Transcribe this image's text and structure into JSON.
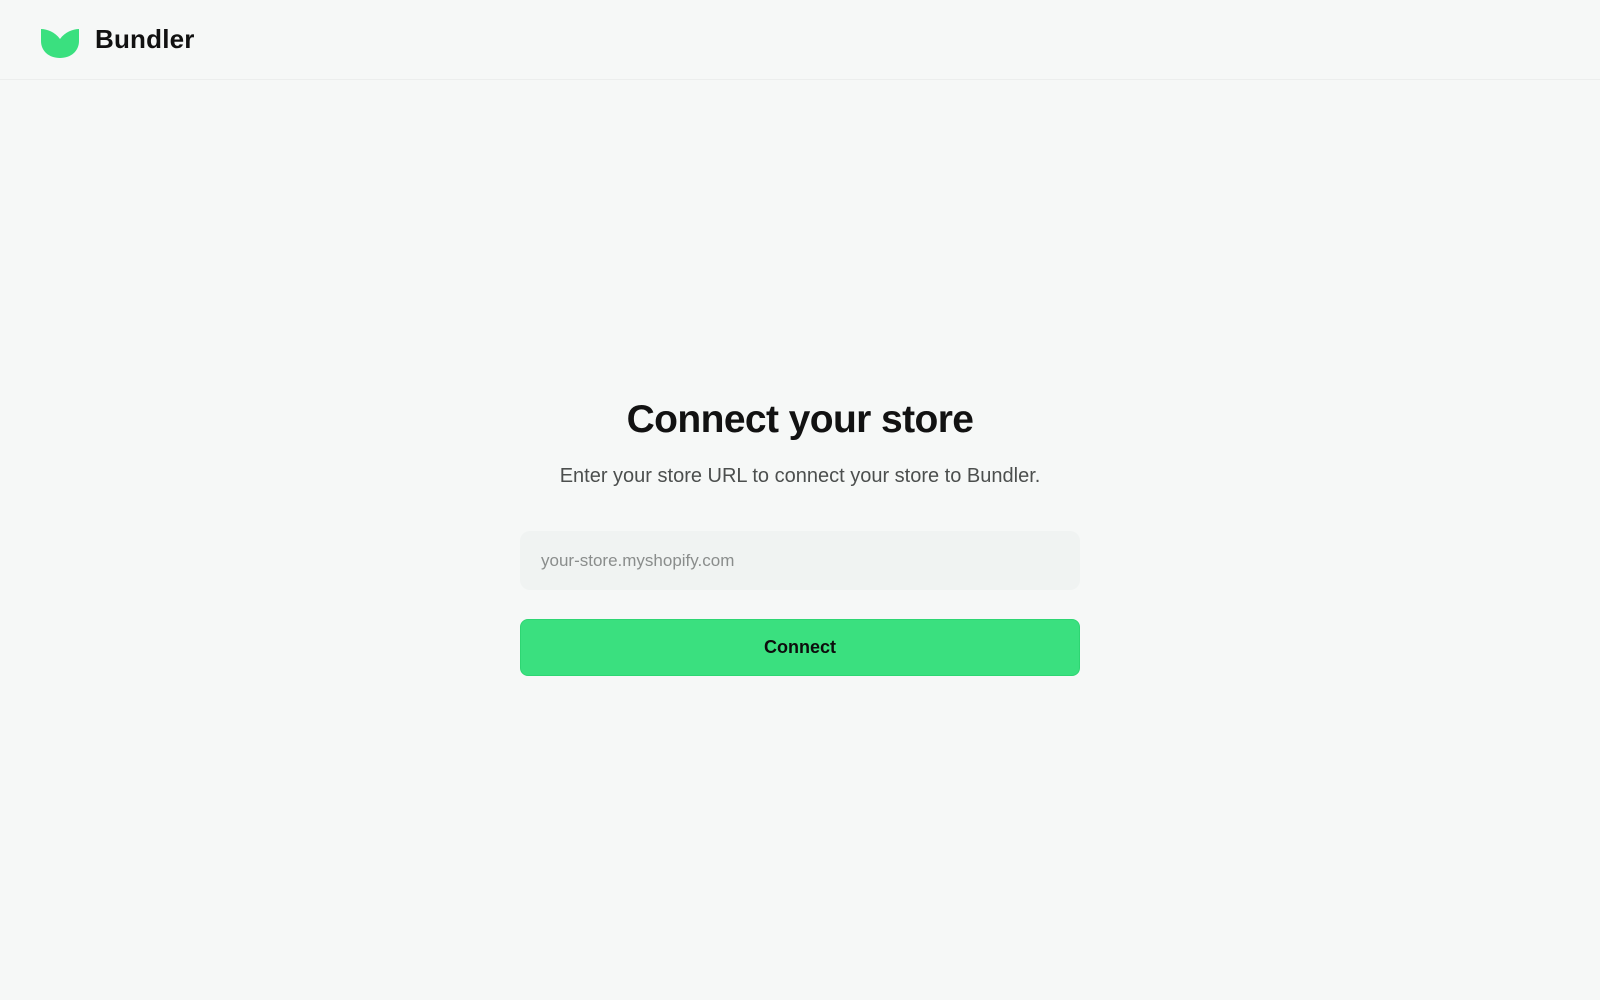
{
  "header": {
    "brand_name": "Bundler",
    "logo_icon": "bundler-leaf-logo",
    "brand_color": "#3ae07f"
  },
  "main": {
    "title": "Connect your store",
    "subtitle": "Enter your store URL to connect your store to Bundler.",
    "store_url_input": {
      "value": "",
      "placeholder": "your-store.myshopify.com"
    },
    "connect_button_label": "Connect"
  },
  "colors": {
    "background": "#f6f8f7",
    "accent": "#3ae07f",
    "input_background": "#f0f3f2"
  }
}
